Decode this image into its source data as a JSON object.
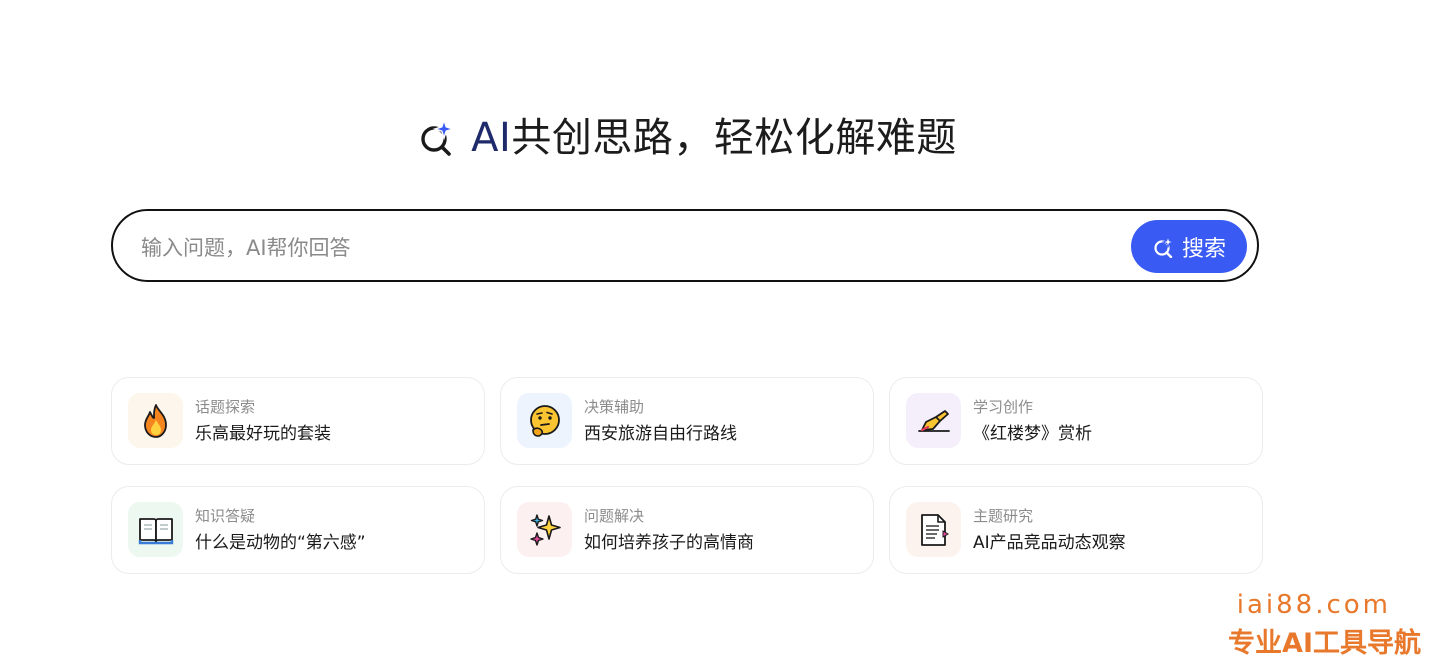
{
  "hero": {
    "title_ai": "AI",
    "title_rest": "共创思路，轻松化解难题"
  },
  "search": {
    "placeholder": "输入问题，AI帮你回答",
    "value": "",
    "button_label": "搜索"
  },
  "cards": [
    {
      "category": "话题探索",
      "question": "乐高最好玩的套装",
      "icon": "fire-icon"
    },
    {
      "category": "决策辅助",
      "question": "西安旅游自由行路线",
      "icon": "thinking-face-icon"
    },
    {
      "category": "学习创作",
      "question": "《红楼梦》赏析",
      "icon": "writing-hand-icon"
    },
    {
      "category": "知识答疑",
      "question": "什么是动物的“第六感”",
      "icon": "open-book-icon"
    },
    {
      "category": "问题解决",
      "question": "如何培养孩子的高情商",
      "icon": "sparkles-icon"
    },
    {
      "category": "主题研究",
      "question": "AI产品竞品动态观察",
      "icon": "document-icon"
    }
  ],
  "watermark": {
    "domain": "iai88.com",
    "slogan": "专业AI工具导航"
  },
  "colors": {
    "accent": "#3a5bf3",
    "watermark": "#e8792c"
  }
}
